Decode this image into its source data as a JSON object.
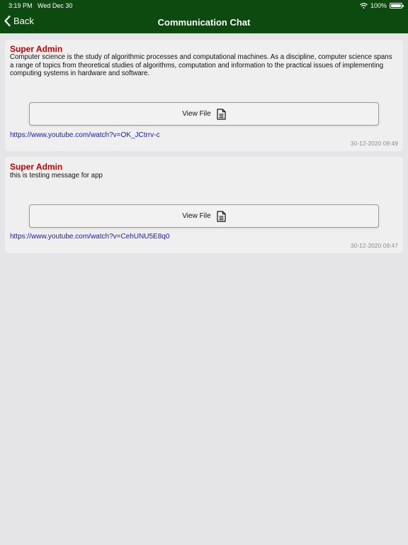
{
  "status_bar": {
    "time": "3:19 PM",
    "date": "Wed Dec 30",
    "wifi_icon": "wifi-icon",
    "battery_percent": "100%",
    "battery_icon": "battery-icon"
  },
  "navbar": {
    "back_icon": "chevron-left-icon",
    "back_label": "Back",
    "title": "Communication Chat",
    "background_color": "#0d4a10"
  },
  "messages": [
    {
      "sender": "Super Admin",
      "body": "Computer science is the study of algorithmic processes and computational machines. As a discipline, computer science spans a range of topics from theoretical studies of algorithms, computation and information to the practical issues of implementing computing systems in hardware and software.",
      "view_file_label": "View File",
      "file_icon": "document-icon",
      "link": "https://www.youtube.com/watch?v=OK_JCtrrv-c",
      "timestamp": "30-12-2020 09:49"
    },
    {
      "sender": "Super Admin",
      "body": "this is testing message for app",
      "view_file_label": "View File",
      "file_icon": "document-icon",
      "link": "https://www.youtube.com/watch?v=CehUNU5E8q0",
      "timestamp": "30-12-2020 09:47"
    }
  ],
  "colors": {
    "sender": "#c40000",
    "link": "#1a1ab8",
    "timestamp": "#8e8e8e",
    "page_background": "#e5e5e7"
  }
}
